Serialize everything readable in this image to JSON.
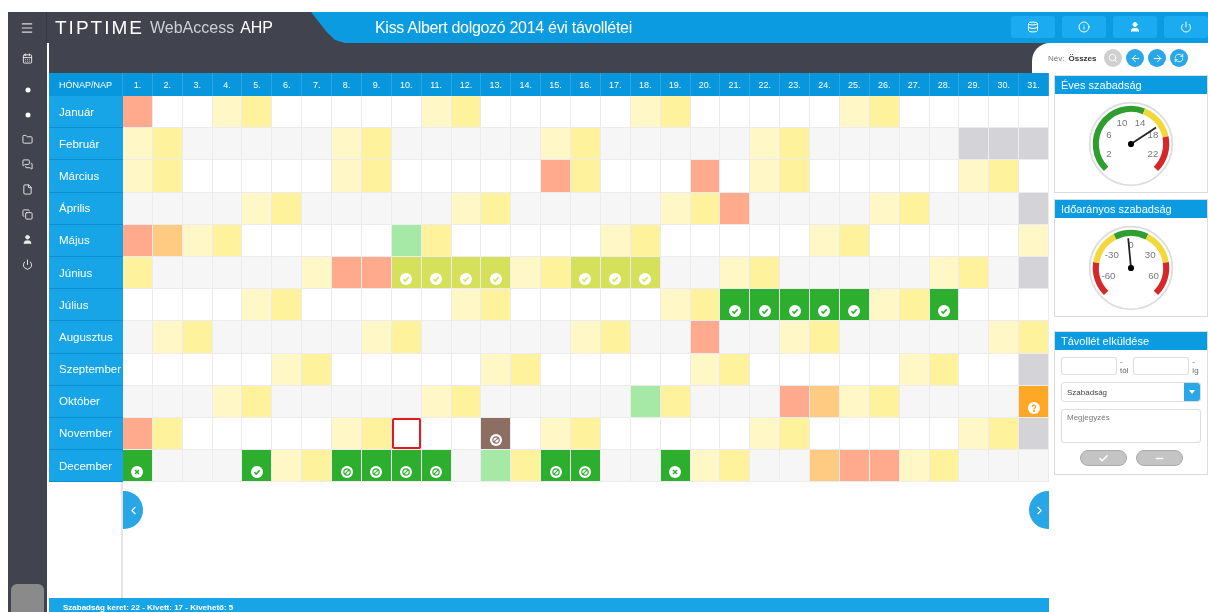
{
  "app": {
    "logo": "TIPTIME",
    "product": "WebAccess",
    "edition": "AHP",
    "title": "Kiss Albert dolgozó 2014 évi távollétei"
  },
  "toolbar": {
    "name_label": "Név:",
    "name_value": "Összes"
  },
  "calendar": {
    "corner": "HÓNAP/NAP",
    "days": [
      "1.",
      "2.",
      "3.",
      "4.",
      "5.",
      "6.",
      "7.",
      "8.",
      "9.",
      "10.",
      "11.",
      "12.",
      "13.",
      "14.",
      "15.",
      "16.",
      "17.",
      "18.",
      "19.",
      "20.",
      "21.",
      "22.",
      "23.",
      "24.",
      "25.",
      "26.",
      "27.",
      "28.",
      "29.",
      "30.",
      "31."
    ],
    "months": [
      {
        "name": "Január",
        "days": [
          {
            "kind": "salmon",
            "selected": false
          },
          {
            "kind": "white",
            "selected": false
          },
          {
            "kind": "white",
            "selected": false
          },
          {
            "kind": "pale",
            "selected": false
          },
          {
            "kind": "yellow",
            "selected": false
          },
          {
            "kind": "white",
            "selected": false
          },
          {
            "kind": "white",
            "selected": false
          },
          {
            "kind": "white",
            "selected": false
          },
          {
            "kind": "white",
            "selected": false
          },
          {
            "kind": "white",
            "selected": false
          },
          {
            "kind": "pale",
            "selected": false
          },
          {
            "kind": "yellow",
            "selected": false
          },
          {
            "kind": "white",
            "selected": false
          },
          {
            "kind": "white",
            "selected": false
          },
          {
            "kind": "white",
            "selected": false
          },
          {
            "kind": "white",
            "selected": false
          },
          {
            "kind": "white",
            "selected": false
          },
          {
            "kind": "pale",
            "selected": false
          },
          {
            "kind": "yellow",
            "selected": false
          },
          {
            "kind": "white",
            "selected": false
          },
          {
            "kind": "white",
            "selected": false
          },
          {
            "kind": "white",
            "selected": false
          },
          {
            "kind": "white",
            "selected": false
          },
          {
            "kind": "white",
            "selected": false
          },
          {
            "kind": "pale",
            "selected": false
          },
          {
            "kind": "yellow",
            "selected": false
          },
          {
            "kind": "white",
            "selected": false
          },
          {
            "kind": "white",
            "selected": false
          },
          {
            "kind": "white",
            "selected": false
          },
          {
            "kind": "white",
            "selected": false
          },
          {
            "kind": "white",
            "selected": false
          }
        ]
      },
      {
        "name": "Február",
        "days": [
          {
            "kind": "pale",
            "selected": false
          },
          {
            "kind": "yellow",
            "selected": false
          },
          {
            "kind": "grey",
            "selected": false
          },
          {
            "kind": "grey",
            "selected": false
          },
          {
            "kind": "grey",
            "selected": false
          },
          {
            "kind": "grey",
            "selected": false
          },
          {
            "kind": "grey",
            "selected": false
          },
          {
            "kind": "pale",
            "selected": false
          },
          {
            "kind": "yellow",
            "selected": false
          },
          {
            "kind": "grey",
            "selected": false
          },
          {
            "kind": "grey",
            "selected": false
          },
          {
            "kind": "grey",
            "selected": false
          },
          {
            "kind": "grey",
            "selected": false
          },
          {
            "kind": "grey",
            "selected": false
          },
          {
            "kind": "pale",
            "selected": false
          },
          {
            "kind": "yellow",
            "selected": false
          },
          {
            "kind": "grey",
            "selected": false
          },
          {
            "kind": "grey",
            "selected": false
          },
          {
            "kind": "grey",
            "selected": false
          },
          {
            "kind": "grey",
            "selected": false
          },
          {
            "kind": "grey",
            "selected": false
          },
          {
            "kind": "pale",
            "selected": false
          },
          {
            "kind": "yellow",
            "selected": false
          },
          {
            "kind": "grey",
            "selected": false
          },
          {
            "kind": "grey",
            "selected": false
          },
          {
            "kind": "grey",
            "selected": false
          },
          {
            "kind": "grey",
            "selected": false
          },
          {
            "kind": "grey",
            "selected": false
          },
          {
            "kind": "blank",
            "selected": false
          },
          {
            "kind": "blank",
            "selected": false
          },
          {
            "kind": "blank",
            "selected": false
          }
        ]
      },
      {
        "name": "Március",
        "days": [
          {
            "kind": "pale",
            "selected": false
          },
          {
            "kind": "yellow",
            "selected": false
          },
          {
            "kind": "white",
            "selected": false
          },
          {
            "kind": "white",
            "selected": false
          },
          {
            "kind": "white",
            "selected": false
          },
          {
            "kind": "white",
            "selected": false
          },
          {
            "kind": "white",
            "selected": false
          },
          {
            "kind": "pale",
            "selected": false
          },
          {
            "kind": "yellow",
            "selected": false
          },
          {
            "kind": "white",
            "selected": false
          },
          {
            "kind": "white",
            "selected": false
          },
          {
            "kind": "white",
            "selected": false
          },
          {
            "kind": "white",
            "selected": false
          },
          {
            "kind": "white",
            "selected": false
          },
          {
            "kind": "salmon",
            "selected": false
          },
          {
            "kind": "yellow",
            "selected": false
          },
          {
            "kind": "white",
            "selected": false
          },
          {
            "kind": "white",
            "selected": false
          },
          {
            "kind": "white",
            "selected": false
          },
          {
            "kind": "salmon",
            "selected": false
          },
          {
            "kind": "white",
            "selected": false
          },
          {
            "kind": "pale",
            "selected": false
          },
          {
            "kind": "yellow",
            "selected": false
          },
          {
            "kind": "white",
            "selected": false
          },
          {
            "kind": "white",
            "selected": false
          },
          {
            "kind": "white",
            "selected": false
          },
          {
            "kind": "white",
            "selected": false
          },
          {
            "kind": "white",
            "selected": false
          },
          {
            "kind": "pale",
            "selected": false
          },
          {
            "kind": "yellow",
            "selected": false
          },
          {
            "kind": "white",
            "selected": false
          }
        ]
      },
      {
        "name": "Április",
        "days": [
          {
            "kind": "grey",
            "selected": false
          },
          {
            "kind": "grey",
            "selected": false
          },
          {
            "kind": "grey",
            "selected": false
          },
          {
            "kind": "grey",
            "selected": false
          },
          {
            "kind": "pale",
            "selected": false
          },
          {
            "kind": "yellow",
            "selected": false
          },
          {
            "kind": "grey",
            "selected": false
          },
          {
            "kind": "grey",
            "selected": false
          },
          {
            "kind": "grey",
            "selected": false
          },
          {
            "kind": "grey",
            "selected": false
          },
          {
            "kind": "grey",
            "selected": false
          },
          {
            "kind": "pale",
            "selected": false
          },
          {
            "kind": "yellow",
            "selected": false
          },
          {
            "kind": "grey",
            "selected": false
          },
          {
            "kind": "grey",
            "selected": false
          },
          {
            "kind": "grey",
            "selected": false
          },
          {
            "kind": "grey",
            "selected": false
          },
          {
            "kind": "grey",
            "selected": false
          },
          {
            "kind": "pale",
            "selected": false
          },
          {
            "kind": "yellow",
            "selected": false
          },
          {
            "kind": "salmon",
            "selected": false
          },
          {
            "kind": "grey",
            "selected": false
          },
          {
            "kind": "grey",
            "selected": false
          },
          {
            "kind": "grey",
            "selected": false
          },
          {
            "kind": "grey",
            "selected": false
          },
          {
            "kind": "pale",
            "selected": false
          },
          {
            "kind": "yellow",
            "selected": false
          },
          {
            "kind": "grey",
            "selected": false
          },
          {
            "kind": "grey",
            "selected": false
          },
          {
            "kind": "grey",
            "selected": false
          },
          {
            "kind": "blank",
            "selected": false
          }
        ]
      },
      {
        "name": "Május",
        "days": [
          {
            "kind": "salmon",
            "selected": false
          },
          {
            "kind": "peach",
            "selected": false
          },
          {
            "kind": "pale",
            "selected": false
          },
          {
            "kind": "yellow",
            "selected": false
          },
          {
            "kind": "white",
            "selected": false
          },
          {
            "kind": "white",
            "selected": false
          },
          {
            "kind": "white",
            "selected": false
          },
          {
            "kind": "white",
            "selected": false
          },
          {
            "kind": "white",
            "selected": false
          },
          {
            "kind": "mint",
            "selected": false
          },
          {
            "kind": "yellow",
            "selected": false
          },
          {
            "kind": "white",
            "selected": false
          },
          {
            "kind": "white",
            "selected": false
          },
          {
            "kind": "white",
            "selected": false
          },
          {
            "kind": "white",
            "selected": false
          },
          {
            "kind": "white",
            "selected": false
          },
          {
            "kind": "pale",
            "selected": false
          },
          {
            "kind": "yellow",
            "selected": false
          },
          {
            "kind": "white",
            "selected": false
          },
          {
            "kind": "white",
            "selected": false
          },
          {
            "kind": "white",
            "selected": false
          },
          {
            "kind": "white",
            "selected": false
          },
          {
            "kind": "white",
            "selected": false
          },
          {
            "kind": "pale",
            "selected": false
          },
          {
            "kind": "yellow",
            "selected": false
          },
          {
            "kind": "white",
            "selected": false
          },
          {
            "kind": "white",
            "selected": false
          },
          {
            "kind": "white",
            "selected": false
          },
          {
            "kind": "white",
            "selected": false
          },
          {
            "kind": "white",
            "selected": false
          },
          {
            "kind": "pale",
            "selected": false
          }
        ]
      },
      {
        "name": "Június",
        "days": [
          {
            "kind": "yellow",
            "selected": false
          },
          {
            "kind": "grey",
            "selected": false
          },
          {
            "kind": "grey",
            "selected": false
          },
          {
            "kind": "grey",
            "selected": false
          },
          {
            "kind": "grey",
            "selected": false
          },
          {
            "kind": "grey",
            "selected": false
          },
          {
            "kind": "pale",
            "selected": false
          },
          {
            "kind": "salmon",
            "selected": false
          },
          {
            "kind": "salmon",
            "selected": false
          },
          {
            "kind": "planned",
            "selected": false
          },
          {
            "kind": "planned",
            "selected": false
          },
          {
            "kind": "planned",
            "selected": false
          },
          {
            "kind": "planned",
            "selected": false
          },
          {
            "kind": "pale",
            "selected": false
          },
          {
            "kind": "yellow",
            "selected": false
          },
          {
            "kind": "planned",
            "selected": false
          },
          {
            "kind": "planned",
            "selected": false
          },
          {
            "kind": "planned",
            "selected": false
          },
          {
            "kind": "grey",
            "selected": false
          },
          {
            "kind": "grey",
            "selected": false
          },
          {
            "kind": "pale",
            "selected": false
          },
          {
            "kind": "yellow",
            "selected": false
          },
          {
            "kind": "grey",
            "selected": false
          },
          {
            "kind": "grey",
            "selected": false
          },
          {
            "kind": "grey",
            "selected": false
          },
          {
            "kind": "grey",
            "selected": false
          },
          {
            "kind": "grey",
            "selected": false
          },
          {
            "kind": "pale",
            "selected": false
          },
          {
            "kind": "yellow",
            "selected": false
          },
          {
            "kind": "grey",
            "selected": false
          },
          {
            "kind": "blank",
            "selected": false
          }
        ]
      },
      {
        "name": "Július",
        "days": [
          {
            "kind": "white",
            "selected": false
          },
          {
            "kind": "white",
            "selected": false
          },
          {
            "kind": "white",
            "selected": false
          },
          {
            "kind": "white",
            "selected": false
          },
          {
            "kind": "pale",
            "selected": false
          },
          {
            "kind": "yellow",
            "selected": false
          },
          {
            "kind": "white",
            "selected": false
          },
          {
            "kind": "white",
            "selected": false
          },
          {
            "kind": "white",
            "selected": false
          },
          {
            "kind": "white",
            "selected": false
          },
          {
            "kind": "white",
            "selected": false
          },
          {
            "kind": "pale",
            "selected": false
          },
          {
            "kind": "yellow",
            "selected": false
          },
          {
            "kind": "white",
            "selected": false
          },
          {
            "kind": "white",
            "selected": false
          },
          {
            "kind": "white",
            "selected": false
          },
          {
            "kind": "white",
            "selected": false
          },
          {
            "kind": "white",
            "selected": false
          },
          {
            "kind": "pale",
            "selected": false
          },
          {
            "kind": "yellow",
            "selected": false
          },
          {
            "kind": "approved",
            "selected": false
          },
          {
            "kind": "approved",
            "selected": false
          },
          {
            "kind": "approved",
            "selected": false
          },
          {
            "kind": "approved",
            "selected": false
          },
          {
            "kind": "approved",
            "selected": false
          },
          {
            "kind": "pale",
            "selected": false
          },
          {
            "kind": "yellow",
            "selected": false
          },
          {
            "kind": "approved",
            "selected": false
          },
          {
            "kind": "white",
            "selected": false
          },
          {
            "kind": "white",
            "selected": false
          },
          {
            "kind": "white",
            "selected": false
          }
        ]
      },
      {
        "name": "Augusztus",
        "days": [
          {
            "kind": "grey",
            "selected": false
          },
          {
            "kind": "pale",
            "selected": false
          },
          {
            "kind": "yellow",
            "selected": false
          },
          {
            "kind": "grey",
            "selected": false
          },
          {
            "kind": "grey",
            "selected": false
          },
          {
            "kind": "grey",
            "selected": false
          },
          {
            "kind": "grey",
            "selected": false
          },
          {
            "kind": "grey",
            "selected": false
          },
          {
            "kind": "pale",
            "selected": false
          },
          {
            "kind": "yellow",
            "selected": false
          },
          {
            "kind": "grey",
            "selected": false
          },
          {
            "kind": "grey",
            "selected": false
          },
          {
            "kind": "grey",
            "selected": false
          },
          {
            "kind": "grey",
            "selected": false
          },
          {
            "kind": "grey",
            "selected": false
          },
          {
            "kind": "pale",
            "selected": false
          },
          {
            "kind": "yellow",
            "selected": false
          },
          {
            "kind": "grey",
            "selected": false
          },
          {
            "kind": "grey",
            "selected": false
          },
          {
            "kind": "salmon",
            "selected": false
          },
          {
            "kind": "grey",
            "selected": false
          },
          {
            "kind": "grey",
            "selected": false
          },
          {
            "kind": "pale",
            "selected": false
          },
          {
            "kind": "yellow",
            "selected": false
          },
          {
            "kind": "grey",
            "selected": false
          },
          {
            "kind": "grey",
            "selected": false
          },
          {
            "kind": "grey",
            "selected": false
          },
          {
            "kind": "grey",
            "selected": false
          },
          {
            "kind": "grey",
            "selected": false
          },
          {
            "kind": "pale",
            "selected": false
          },
          {
            "kind": "yellow",
            "selected": false
          }
        ]
      },
      {
        "name": "Szeptember",
        "days": [
          {
            "kind": "white",
            "selected": false
          },
          {
            "kind": "white",
            "selected": false
          },
          {
            "kind": "white",
            "selected": false
          },
          {
            "kind": "white",
            "selected": false
          },
          {
            "kind": "white",
            "selected": false
          },
          {
            "kind": "pale",
            "selected": false
          },
          {
            "kind": "yellow",
            "selected": false
          },
          {
            "kind": "white",
            "selected": false
          },
          {
            "kind": "white",
            "selected": false
          },
          {
            "kind": "white",
            "selected": false
          },
          {
            "kind": "white",
            "selected": false
          },
          {
            "kind": "white",
            "selected": false
          },
          {
            "kind": "pale",
            "selected": false
          },
          {
            "kind": "yellow",
            "selected": false
          },
          {
            "kind": "white",
            "selected": false
          },
          {
            "kind": "white",
            "selected": false
          },
          {
            "kind": "white",
            "selected": false
          },
          {
            "kind": "white",
            "selected": false
          },
          {
            "kind": "white",
            "selected": false
          },
          {
            "kind": "pale",
            "selected": false
          },
          {
            "kind": "yellow",
            "selected": false
          },
          {
            "kind": "white",
            "selected": false
          },
          {
            "kind": "white",
            "selected": false
          },
          {
            "kind": "white",
            "selected": false
          },
          {
            "kind": "white",
            "selected": false
          },
          {
            "kind": "white",
            "selected": false
          },
          {
            "kind": "pale",
            "selected": false
          },
          {
            "kind": "yellow",
            "selected": false
          },
          {
            "kind": "white",
            "selected": false
          },
          {
            "kind": "white",
            "selected": false
          },
          {
            "kind": "blank",
            "selected": false
          }
        ]
      },
      {
        "name": "Október",
        "days": [
          {
            "kind": "grey",
            "selected": false
          },
          {
            "kind": "grey",
            "selected": false
          },
          {
            "kind": "grey",
            "selected": false
          },
          {
            "kind": "pale",
            "selected": false
          },
          {
            "kind": "yellow",
            "selected": false
          },
          {
            "kind": "grey",
            "selected": false
          },
          {
            "kind": "grey",
            "selected": false
          },
          {
            "kind": "grey",
            "selected": false
          },
          {
            "kind": "grey",
            "selected": false
          },
          {
            "kind": "grey",
            "selected": false
          },
          {
            "kind": "pale",
            "selected": false
          },
          {
            "kind": "yellow",
            "selected": false
          },
          {
            "kind": "grey",
            "selected": false
          },
          {
            "kind": "grey",
            "selected": false
          },
          {
            "kind": "grey",
            "selected": false
          },
          {
            "kind": "grey",
            "selected": false
          },
          {
            "kind": "grey",
            "selected": false
          },
          {
            "kind": "mint",
            "selected": false
          },
          {
            "kind": "yellow",
            "selected": false
          },
          {
            "kind": "grey",
            "selected": false
          },
          {
            "kind": "grey",
            "selected": false
          },
          {
            "kind": "grey",
            "selected": false
          },
          {
            "kind": "salmon",
            "selected": false
          },
          {
            "kind": "peach",
            "selected": false
          },
          {
            "kind": "pale",
            "selected": false
          },
          {
            "kind": "yellow",
            "selected": false
          },
          {
            "kind": "grey",
            "selected": false
          },
          {
            "kind": "grey",
            "selected": false
          },
          {
            "kind": "grey",
            "selected": false
          },
          {
            "kind": "grey",
            "selected": false
          },
          {
            "kind": "pending",
            "selected": false
          }
        ]
      },
      {
        "name": "November",
        "days": [
          {
            "kind": "salmon",
            "selected": false
          },
          {
            "kind": "yellow",
            "selected": false
          },
          {
            "kind": "white",
            "selected": false
          },
          {
            "kind": "white",
            "selected": false
          },
          {
            "kind": "white",
            "selected": false
          },
          {
            "kind": "white",
            "selected": false
          },
          {
            "kind": "white",
            "selected": false
          },
          {
            "kind": "pale",
            "selected": false
          },
          {
            "kind": "yellow",
            "selected": false
          },
          {
            "kind": "white",
            "selected": true
          },
          {
            "kind": "white",
            "selected": false
          },
          {
            "kind": "white",
            "selected": false
          },
          {
            "kind": "revoked",
            "selected": false
          },
          {
            "kind": "white",
            "selected": false
          },
          {
            "kind": "pale",
            "selected": false
          },
          {
            "kind": "yellow",
            "selected": false
          },
          {
            "kind": "white",
            "selected": false
          },
          {
            "kind": "white",
            "selected": false
          },
          {
            "kind": "white",
            "selected": false
          },
          {
            "kind": "white",
            "selected": false
          },
          {
            "kind": "white",
            "selected": false
          },
          {
            "kind": "pale",
            "selected": false
          },
          {
            "kind": "yellow",
            "selected": false
          },
          {
            "kind": "white",
            "selected": false
          },
          {
            "kind": "white",
            "selected": false
          },
          {
            "kind": "white",
            "selected": false
          },
          {
            "kind": "white",
            "selected": false
          },
          {
            "kind": "white",
            "selected": false
          },
          {
            "kind": "pale",
            "selected": false
          },
          {
            "kind": "yellow",
            "selected": false
          },
          {
            "kind": "blank",
            "selected": false
          }
        ]
      },
      {
        "name": "December",
        "days": [
          {
            "kind": "rejected",
            "selected": false
          },
          {
            "kind": "grey",
            "selected": false
          },
          {
            "kind": "grey",
            "selected": false
          },
          {
            "kind": "grey",
            "selected": false
          },
          {
            "kind": "approved",
            "selected": false
          },
          {
            "kind": "pale",
            "selected": false
          },
          {
            "kind": "yellow",
            "selected": false
          },
          {
            "kind": "cancelled",
            "selected": false
          },
          {
            "kind": "cancelled",
            "selected": false
          },
          {
            "kind": "cancelled",
            "selected": false
          },
          {
            "kind": "cancelled",
            "selected": false
          },
          {
            "kind": "grey",
            "selected": false
          },
          {
            "kind": "mint",
            "selected": false
          },
          {
            "kind": "yellow",
            "selected": false
          },
          {
            "kind": "cancelled",
            "selected": false
          },
          {
            "kind": "cancelled",
            "selected": false
          },
          {
            "kind": "grey",
            "selected": false
          },
          {
            "kind": "grey",
            "selected": false
          },
          {
            "kind": "rejected",
            "selected": false
          },
          {
            "kind": "pale",
            "selected": false
          },
          {
            "kind": "yellow",
            "selected": false
          },
          {
            "kind": "grey",
            "selected": false
          },
          {
            "kind": "grey",
            "selected": false
          },
          {
            "kind": "peach",
            "selected": false
          },
          {
            "kind": "salmon",
            "selected": false
          },
          {
            "kind": "salmon",
            "selected": false
          },
          {
            "kind": "pale",
            "selected": false
          },
          {
            "kind": "yellow",
            "selected": false
          },
          {
            "kind": "grey",
            "selected": false
          },
          {
            "kind": "grey",
            "selected": false
          },
          {
            "kind": "grey",
            "selected": false
          }
        ]
      }
    ]
  },
  "gauges": [
    {
      "title": "Éves szabadság",
      "kind": "quota",
      "level": 0.71,
      "labels": [
        "2",
        "6",
        "10",
        "14",
        "18",
        "22"
      ]
    },
    {
      "title": "Időarányos szabadság",
      "kind": "balance",
      "level": 0.48,
      "labels": [
        "-60",
        "-30",
        "0",
        "30",
        "60"
      ]
    }
  ],
  "absence_form": {
    "title": "Távollét elküldése",
    "from_suffix": "- tól",
    "to_suffix": "- ig",
    "type_value": "Szabadság",
    "note_placeholder": "Megjegyzés"
  },
  "status_bar": "Szabadság keret: 22 - Kivett: 17 - Kivehető: 5"
}
